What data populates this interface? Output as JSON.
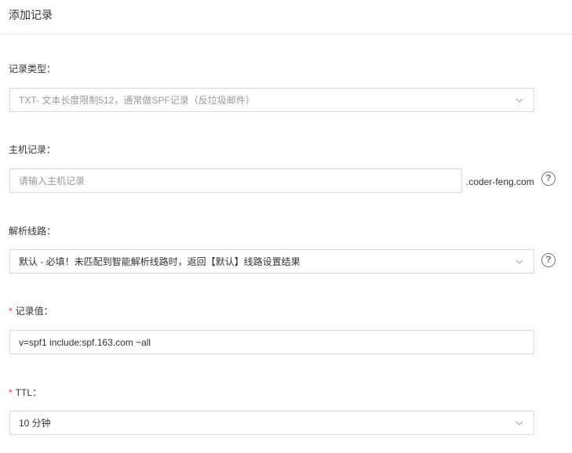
{
  "header": {
    "title": "添加记录"
  },
  "form": {
    "record_type": {
      "label": "记录类型：",
      "selected": "TXT- 文本长度限制512，通常做SPF记录（反垃圾邮件）"
    },
    "host": {
      "label": "主机记录：",
      "placeholder": "请输入主机记录",
      "suffix": ".coder-feng.com",
      "help": "?"
    },
    "route": {
      "label": "解析线路：",
      "selected": "默认 - 必填！未匹配到智能解析线路时，返回【默认】线路设置结果",
      "help": "?"
    },
    "record_value": {
      "required_mark": "*",
      "label": "记录值：",
      "value": "v=spf1 include:spf.163.com ~all"
    },
    "ttl": {
      "required_mark": "*",
      "label": "TTL：",
      "selected": "10 分钟"
    }
  },
  "icons": {
    "dropdown": "chevron-down-icon",
    "help": "question-circle-icon"
  },
  "colors": {
    "required": "#e4393c",
    "border": "#d9d9d9",
    "placeholder": "#999999"
  }
}
